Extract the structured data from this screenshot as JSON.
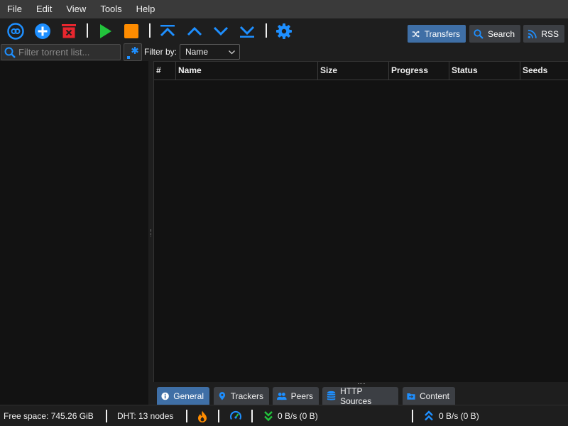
{
  "menu": [
    "File",
    "Edit",
    "View",
    "Tools",
    "Help"
  ],
  "toolbar": {
    "tabs": [
      {
        "label": "Transfers",
        "icon": "shuffle-icon",
        "active": true
      },
      {
        "label": "Search",
        "icon": "search-icon",
        "active": false
      },
      {
        "label": "RSS",
        "icon": "rss-icon",
        "active": false
      }
    ]
  },
  "filter": {
    "placeholder": "Filter torrent list...",
    "filter_by_label": "Filter by:",
    "selected": "Name"
  },
  "table": {
    "columns": [
      "#",
      "Name",
      "Size",
      "Progress",
      "Status",
      "Seeds"
    ]
  },
  "bottom_tabs": [
    "General",
    "Trackers",
    "Peers",
    "HTTP Sources",
    "Content"
  ],
  "status": {
    "free_space": "Free space: 745.26 GiB",
    "dht": "DHT: 13 nodes",
    "download": "0 B/s (0 B)",
    "upload": "0 B/s (0 B)"
  },
  "colors": {
    "accent": "#3f6fa6",
    "icon_blue": "#1e8fff",
    "play_green": "#22c33c",
    "stop_orange": "#ff8c00",
    "delete_red": "#e8262e"
  }
}
